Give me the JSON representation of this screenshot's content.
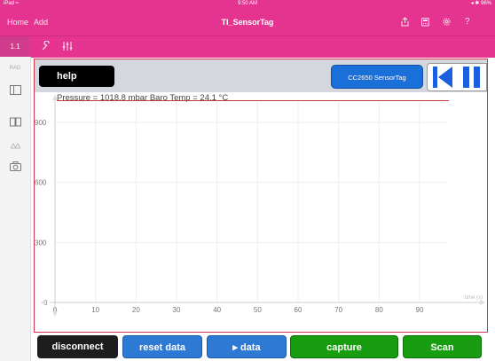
{
  "status": {
    "left": "iPad ≈",
    "time": "9:50 AM",
    "right": "◂ ✱ 96%"
  },
  "nav": {
    "home": "Home",
    "add": "Add",
    "title": "TI_SensorTag"
  },
  "toolbar": {
    "tab": "1.1"
  },
  "sidebar": {
    "rad": "RAD"
  },
  "header": {
    "help": "help",
    "device": "CC2650 SensorTag"
  },
  "legend": "Pressure = 1018.8 mbar Baro Temp = 24.1 °C",
  "chart_data": {
    "type": "line",
    "xlabel": "time (s)",
    "xlim": [
      0,
      100
    ],
    "ylim": [
      0,
      1050
    ],
    "x_ticks": [
      "0",
      "10",
      "20",
      "30",
      "40",
      "50",
      "60",
      "70",
      "80",
      "90"
    ],
    "y_ticks": [
      "0",
      "300",
      "600",
      "900"
    ],
    "series": []
  },
  "buttons": {
    "disconnect": "disconnect",
    "reset": "reset data",
    "data": "▸ data",
    "capture": "capture",
    "scan": "Scan"
  },
  "colors": {
    "accent": "#e5348f",
    "blue": "#2d79d3",
    "green": "#189d10"
  }
}
